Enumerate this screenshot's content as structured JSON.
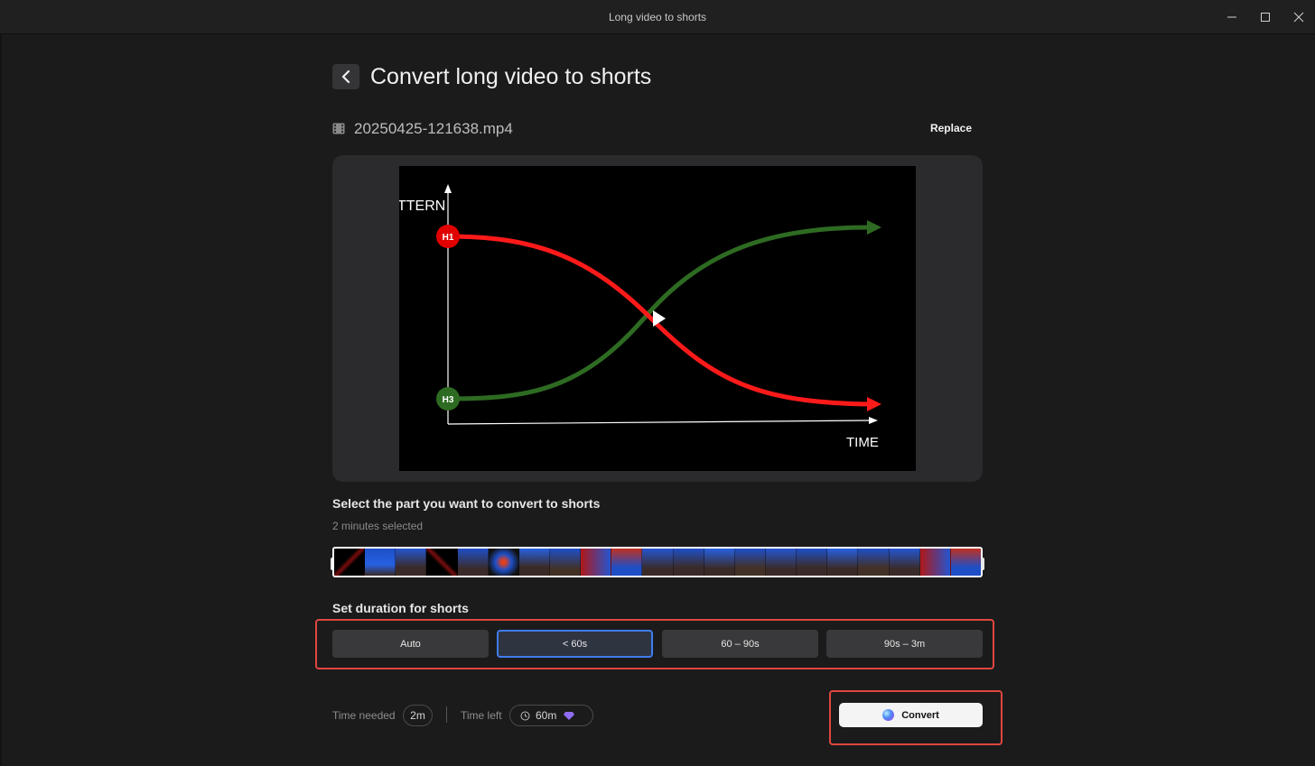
{
  "window": {
    "title": "Long video to shorts"
  },
  "header": {
    "title": "Convert long video to shorts"
  },
  "file": {
    "name": "20250425-121638.mp4",
    "replace_label": "Replace"
  },
  "video": {
    "y_label_partial": "TTERN",
    "x_label": "TIME",
    "marker_top": "H1",
    "marker_bottom": "H3",
    "colors": {
      "red_curve": "#ff1a1a",
      "green_curve": "#2e6b22"
    }
  },
  "selection": {
    "title": "Select the part you want to convert to shorts",
    "subtitle": "2 minutes selected"
  },
  "duration": {
    "title": "Set duration for shorts",
    "options": [
      "Auto",
      "< 60s",
      "60 – 90s",
      "90s – 3m"
    ],
    "selected": "< 60s"
  },
  "footer": {
    "time_needed_label": "Time needed",
    "time_needed_value": "2m",
    "time_left_label": "Time left",
    "time_left_value": "60m",
    "convert_label": "Convert"
  },
  "colors": {
    "accent": "#3f7cf0",
    "highlight_box": "#e0463f"
  }
}
